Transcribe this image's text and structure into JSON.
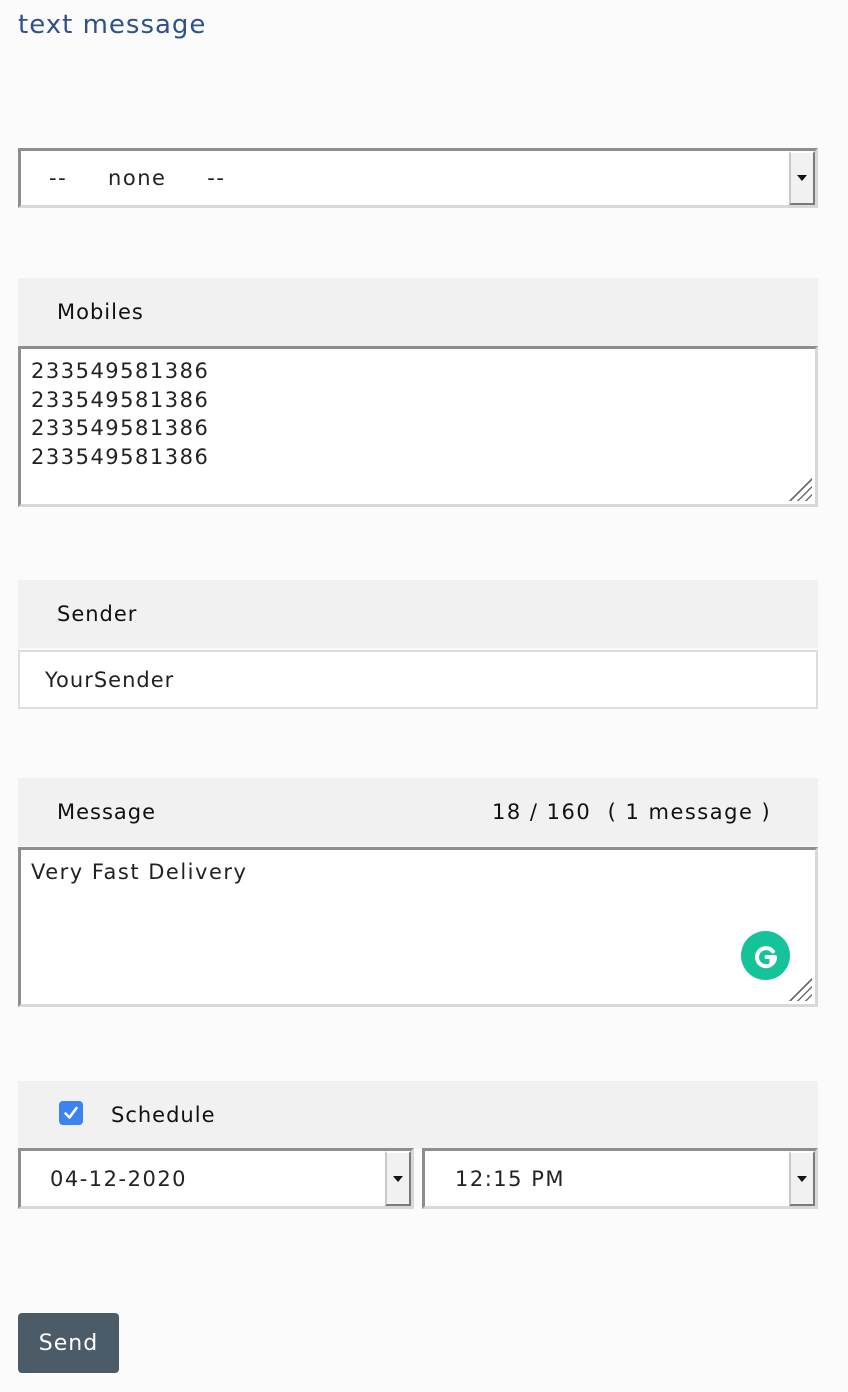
{
  "page": {
    "title": "text message"
  },
  "template_select": {
    "value": "--     none     --"
  },
  "mobiles": {
    "label": "Mobiles",
    "lines": [
      "233549581386",
      "233549581386",
      "233549581386",
      "233549581386"
    ]
  },
  "sender": {
    "label": "Sender",
    "value": "YourSender"
  },
  "message": {
    "label": "Message",
    "counter": "18 / 160  ( 1 message )",
    "value": "Very Fast Delivery"
  },
  "schedule": {
    "label": "Schedule",
    "checked": true,
    "date": "04-12-2020",
    "time": "12:15 PM"
  },
  "actions": {
    "send_label": "Send"
  },
  "colors": {
    "title": "#2f5286",
    "send_button": "#4c5b68",
    "checkbox": "#3b84f0",
    "grammarly": "#15c39a"
  },
  "icons": {
    "grammarly": "grammarly-icon",
    "check": "checkmark-icon",
    "dropdown": "chevron-down-icon"
  }
}
